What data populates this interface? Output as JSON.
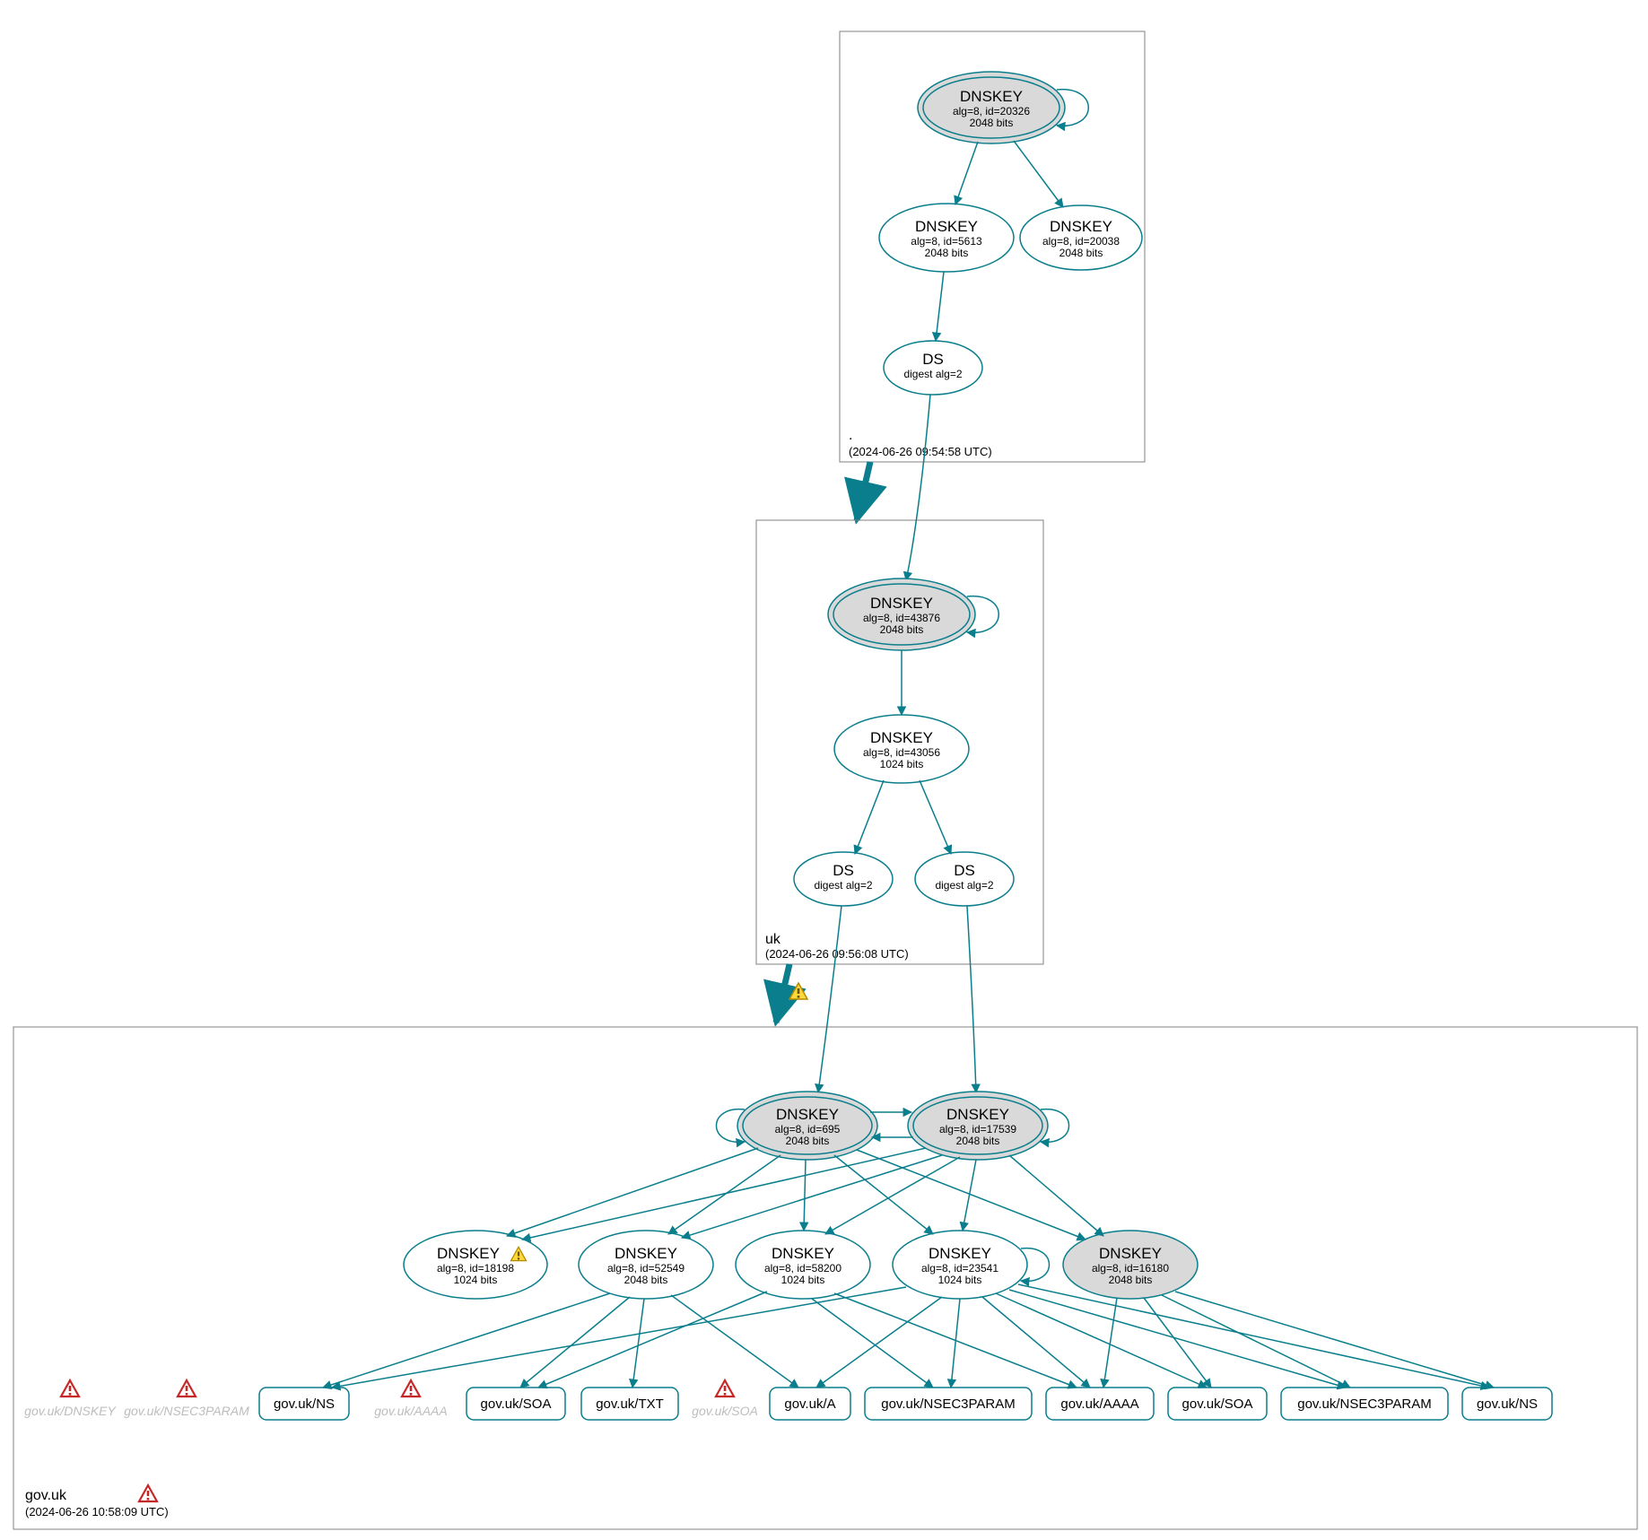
{
  "zones": {
    "root": {
      "name": ".",
      "timestamp": "(2024-06-26 09:54:58 UTC)"
    },
    "uk": {
      "name": "uk",
      "timestamp": "(2024-06-26 09:56:08 UTC)"
    },
    "govuk": {
      "name": "gov.uk",
      "timestamp": "(2024-06-26 10:58:09 UTC)"
    }
  },
  "nodes": {
    "root_ksk": {
      "title": "DNSKEY",
      "line1": "alg=8, id=20326",
      "line2": "2048 bits"
    },
    "root_zsk1": {
      "title": "DNSKEY",
      "line1": "alg=8, id=5613",
      "line2": "2048 bits"
    },
    "root_zsk2": {
      "title": "DNSKEY",
      "line1": "alg=8, id=20038",
      "line2": "2048 bits"
    },
    "root_ds": {
      "title": "DS",
      "line1": "digest alg=2",
      "line2": ""
    },
    "uk_ksk": {
      "title": "DNSKEY",
      "line1": "alg=8, id=43876",
      "line2": "2048 bits"
    },
    "uk_zsk": {
      "title": "DNSKEY",
      "line1": "alg=8, id=43056",
      "line2": "1024 bits"
    },
    "uk_ds1": {
      "title": "DS",
      "line1": "digest alg=2",
      "line2": ""
    },
    "uk_ds2": {
      "title": "DS",
      "line1": "digest alg=2",
      "line2": ""
    },
    "gov_ksk1": {
      "title": "DNSKEY",
      "line1": "alg=8, id=695",
      "line2": "2048 bits"
    },
    "gov_ksk2": {
      "title": "DNSKEY",
      "line1": "alg=8, id=17539",
      "line2": "2048 bits"
    },
    "gov_zsk_18198": {
      "title": "DNSKEY",
      "line1": "alg=8, id=18198",
      "line2": "1024 bits"
    },
    "gov_zsk_52549": {
      "title": "DNSKEY",
      "line1": "alg=8, id=52549",
      "line2": "2048 bits"
    },
    "gov_zsk_58200": {
      "title": "DNSKEY",
      "line1": "alg=8, id=58200",
      "line2": "1024 bits"
    },
    "gov_zsk_23541": {
      "title": "DNSKEY",
      "line1": "alg=8, id=23541",
      "line2": "1024 bits"
    },
    "gov_zsk_16180": {
      "title": "DNSKEY",
      "line1": "alg=8, id=16180",
      "line2": "2048 bits"
    }
  },
  "leaves": {
    "ns1": "gov.uk/NS",
    "soa1": "gov.uk/SOA",
    "txt": "gov.uk/TXT",
    "a": "gov.uk/A",
    "n3p1": "gov.uk/NSEC3PARAM",
    "aaaa": "gov.uk/AAAA",
    "soa2": "gov.uk/SOA",
    "n3p2": "gov.uk/NSEC3PARAM",
    "ns2": "gov.uk/NS"
  },
  "ghosts": {
    "dnskey": "gov.uk/DNSKEY",
    "n3p": "gov.uk/NSEC3PARAM",
    "aaaa": "gov.uk/AAAA",
    "soa": "gov.uk/SOA"
  }
}
